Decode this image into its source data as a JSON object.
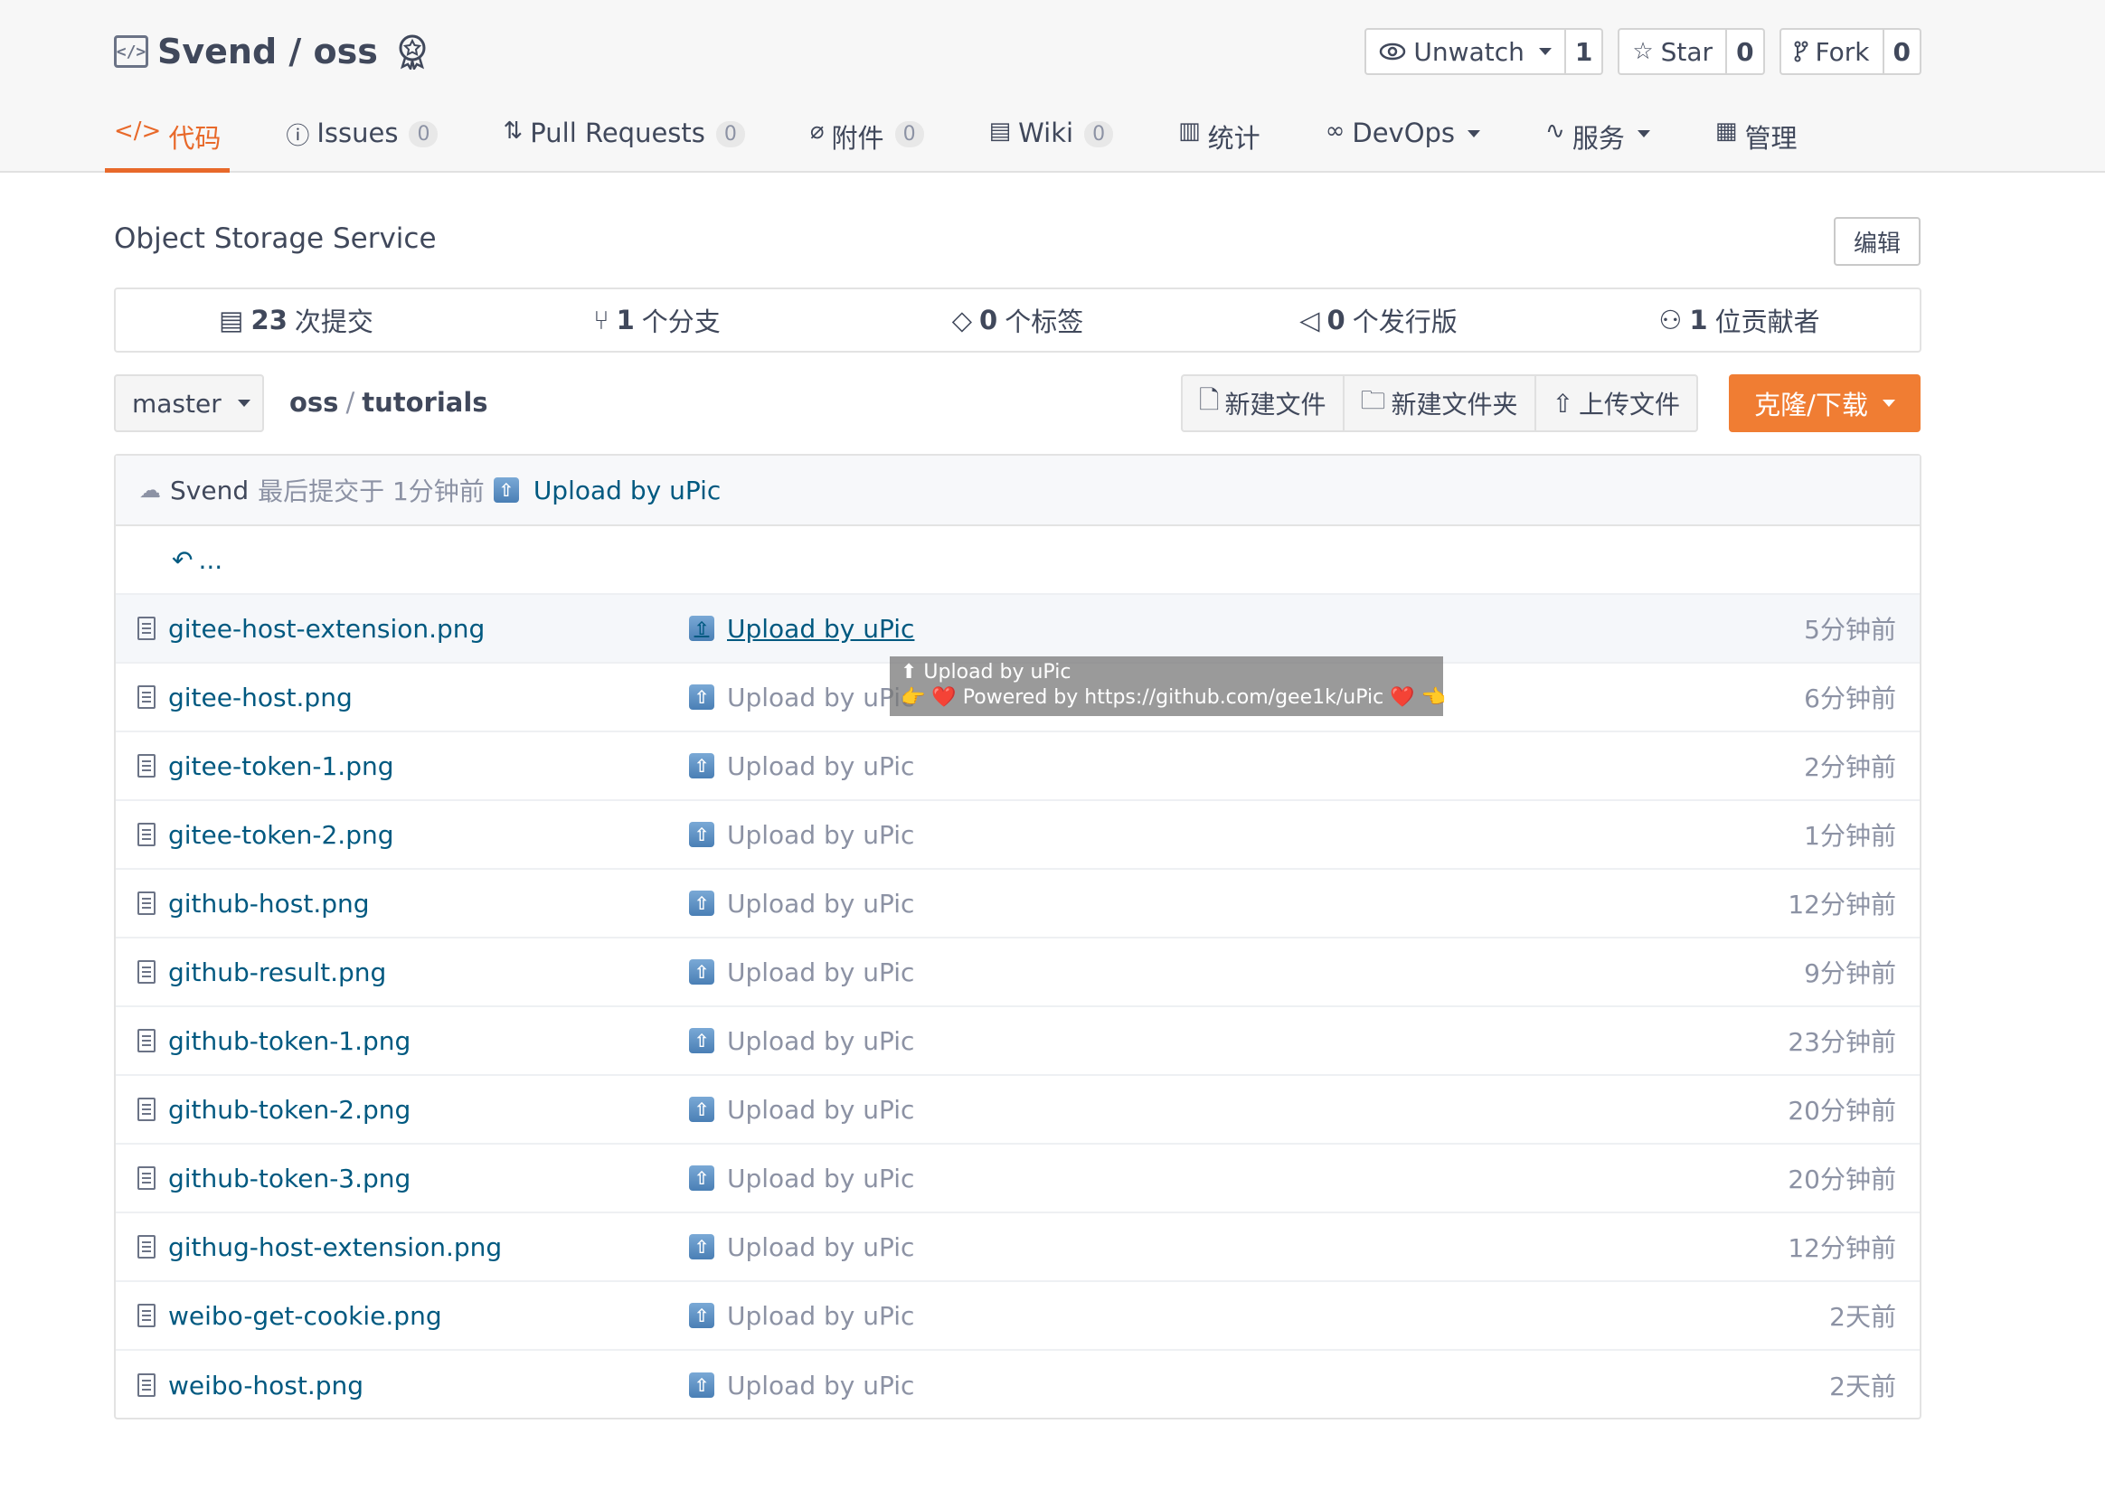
{
  "repo": {
    "title": "Svend / oss"
  },
  "actions": {
    "watch": {
      "label": "Unwatch",
      "count": "1"
    },
    "star": {
      "label": "Star",
      "count": "0"
    },
    "fork": {
      "label": "Fork",
      "count": "0"
    }
  },
  "tabs": [
    {
      "label": "代码",
      "count": ""
    },
    {
      "label": "Issues",
      "count": "0"
    },
    {
      "label": "Pull Requests",
      "count": "0"
    },
    {
      "label": "附件",
      "count": "0"
    },
    {
      "label": "Wiki",
      "count": "0"
    },
    {
      "label": "统计",
      "count": ""
    },
    {
      "label": "DevOps",
      "count": ""
    },
    {
      "label": "服务",
      "count": ""
    },
    {
      "label": "管理",
      "count": ""
    }
  ],
  "description": "Object Storage Service",
  "edit_label": "编辑",
  "stats": [
    {
      "num": "23",
      "text": "次提交"
    },
    {
      "num": "1",
      "text": "个分支"
    },
    {
      "num": "0",
      "text": "个标签"
    },
    {
      "num": "0",
      "text": "个发行版"
    },
    {
      "num": "1",
      "text": "位贡献者"
    }
  ],
  "branch": "master",
  "path": {
    "root": "oss",
    "sep": "/",
    "current": "tutorials"
  },
  "toolbar": {
    "new_file": "新建文件",
    "new_folder": "新建文件夹",
    "upload": "上传文件",
    "clone": "克隆/下载"
  },
  "last_commit": {
    "author": "Svend",
    "when": "最后提交于 1分钟前",
    "message": "Upload by uPic"
  },
  "back_label": "...",
  "files": [
    {
      "name": "gitee-host-extension.png",
      "message": "Upload by uPic",
      "time": "5分钟前"
    },
    {
      "name": "gitee-host.png",
      "message": "Upload by uPic",
      "time": "6分钟前"
    },
    {
      "name": "gitee-token-1.png",
      "message": "Upload by uPic",
      "time": "2分钟前"
    },
    {
      "name": "gitee-token-2.png",
      "message": "Upload by uPic",
      "time": "1分钟前"
    },
    {
      "name": "github-host.png",
      "message": "Upload by uPic",
      "time": "12分钟前"
    },
    {
      "name": "github-result.png",
      "message": "Upload by uPic",
      "time": "9分钟前"
    },
    {
      "name": "github-token-1.png",
      "message": "Upload by uPic",
      "time": "23分钟前"
    },
    {
      "name": "github-token-2.png",
      "message": "Upload by uPic",
      "time": "20分钟前"
    },
    {
      "name": "github-token-3.png",
      "message": "Upload by uPic",
      "time": "20分钟前"
    },
    {
      "name": "githug-host-extension.png",
      "message": "Upload by uPic",
      "time": "12分钟前"
    },
    {
      "name": "weibo-get-cookie.png",
      "message": "Upload by uPic",
      "time": "2天前"
    },
    {
      "name": "weibo-host.png",
      "message": "Upload by uPic",
      "time": "2天前"
    }
  ],
  "tooltip": {
    "line1": "⬆ Upload by uPic",
    "line2": "👉 ❤️ Powered by https://github.com/gee1k/uPic ❤️ 👈"
  },
  "colors": {
    "accent": "#e8692a",
    "clone_button": "#f07d33",
    "link": "#005980"
  }
}
